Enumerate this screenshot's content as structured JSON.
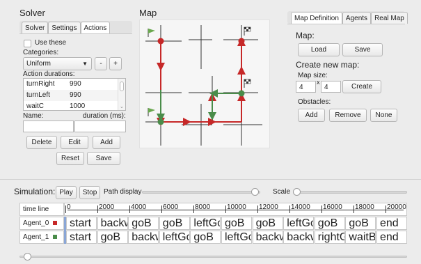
{
  "solver": {
    "title": "Solver",
    "tabs": [
      "Solver",
      "Settings",
      "Actions"
    ],
    "use_these_label": "Use these",
    "categories_label": "Categories:",
    "category_selected": "Uniform",
    "minus_label": "-",
    "plus_label": "+",
    "action_durations_label": "Action durations:",
    "durations": [
      {
        "name": "turnRight",
        "value": "990"
      },
      {
        "name": "turnLeft",
        "value": "990"
      },
      {
        "name": "waitC",
        "value": "1000"
      }
    ],
    "name_label": "Name:",
    "duration_label": "duration (ms):",
    "name_value": "",
    "duration_value": "",
    "delete_label": "Delete",
    "edit_label": "Edit",
    "add_label": "Add",
    "reset_label": "Reset",
    "save_label": "Save"
  },
  "map": {
    "title": "Map"
  },
  "right_panel": {
    "tabs": [
      "Map Definition",
      "Agents",
      "Real Map"
    ],
    "map_heading": "Map:",
    "load_label": "Load",
    "save_label": "Save",
    "create_heading": "Create new map:",
    "map_size_label": "Map size:",
    "size_x": "4",
    "size_sep": "x",
    "size_y": "4",
    "create_label": "Create",
    "obstacles_label": "Obstacles:",
    "add_label": "Add",
    "remove_label": "Remove",
    "none_label": "None"
  },
  "simulation": {
    "label": "Simulation:",
    "play_label": "Play",
    "stop_label": "Stop",
    "path_display_label": "Path display",
    "scale_label": "Scale",
    "path_display_level": 0.96,
    "scale_level": 0.0
  },
  "timeline": {
    "header": "time line",
    "ticks": [
      "0",
      "2000",
      "4000",
      "6000",
      "8000",
      "10000",
      "12000",
      "14000",
      "16000",
      "18000",
      "20000"
    ],
    "agents": [
      {
        "name": "Agent_0",
        "color": "#c62828",
        "actions": [
          "start",
          "backw...",
          "goB",
          "goB",
          "leftGo",
          "goB",
          "goB",
          "leftGo",
          "goB",
          "goB",
          "end"
        ]
      },
      {
        "name": "Agent_1",
        "color": "#4a8c4a",
        "actions": [
          "start",
          "goB",
          "backw...",
          "leftGo",
          "goB",
          "leftGo",
          "backw...",
          "backw...",
          "rightGo",
          "waitB",
          "end"
        ]
      }
    ]
  },
  "colors": {
    "agent0": "#c62828",
    "agent1": "#4a8c4a"
  }
}
